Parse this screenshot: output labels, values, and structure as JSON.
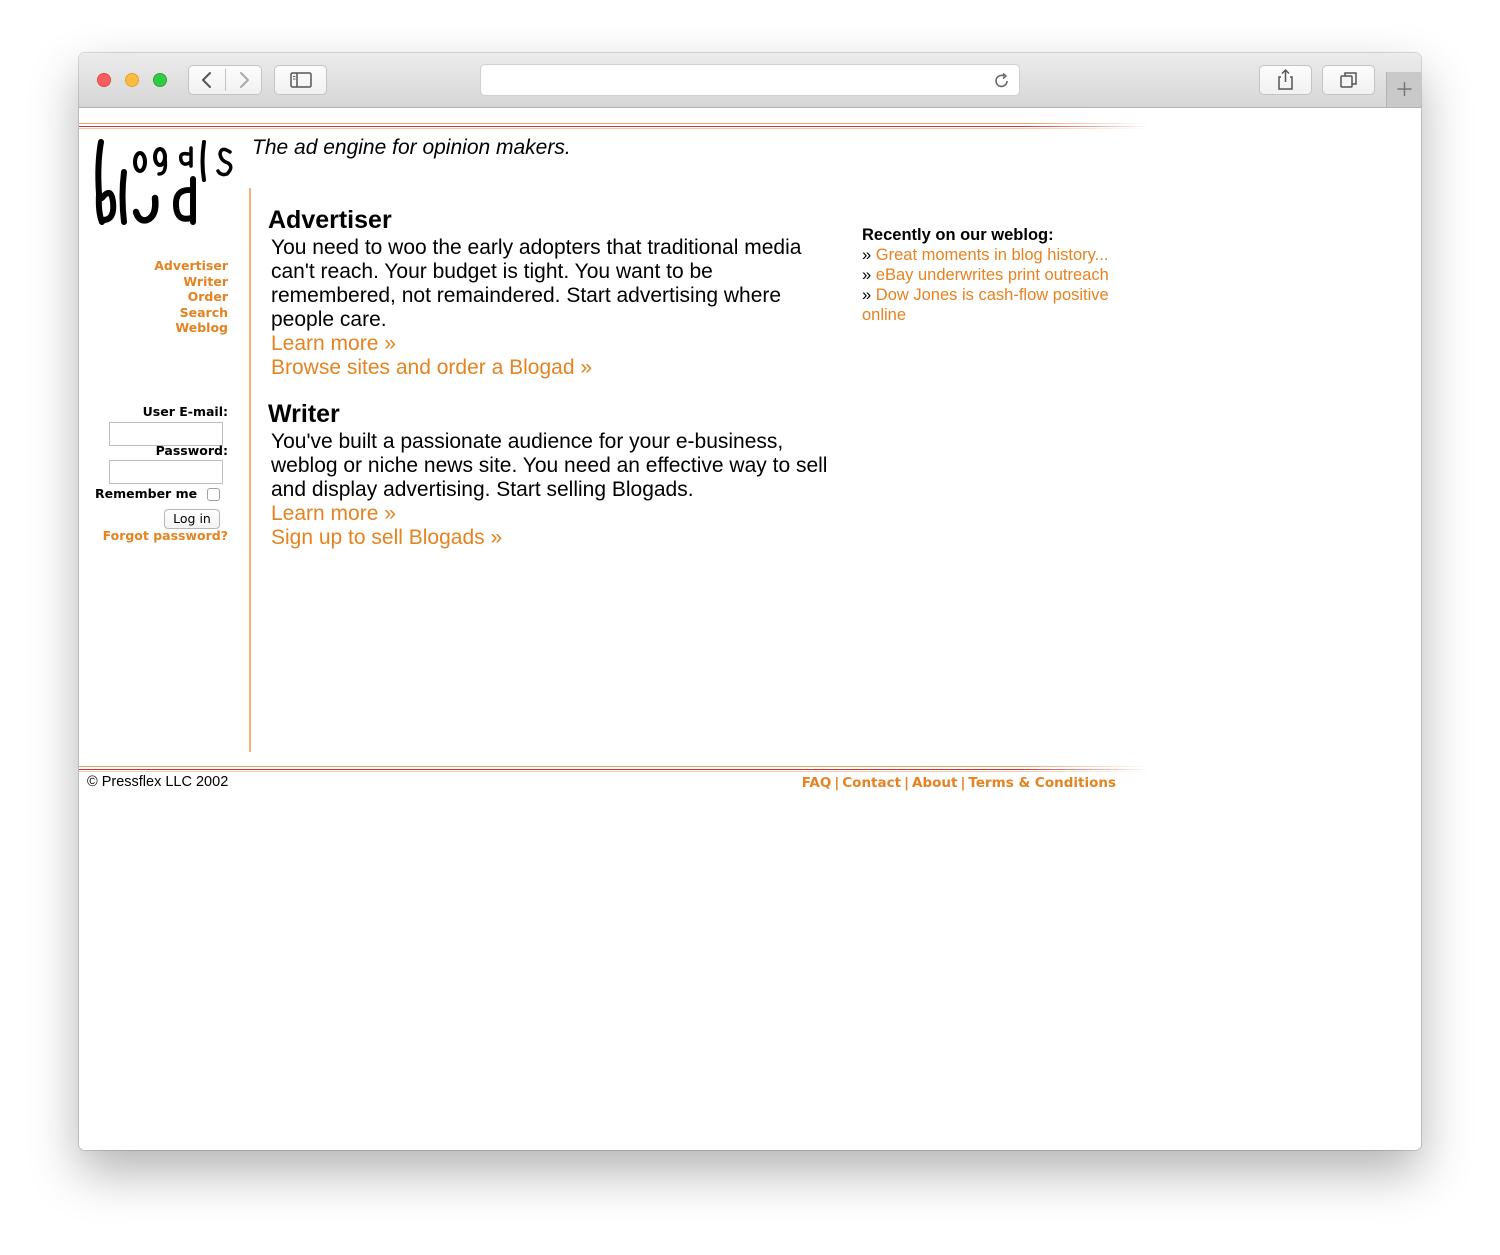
{
  "browser": {
    "icons": [
      "chevron-left-icon",
      "chevron-right-icon",
      "sidebar-icon",
      "reload-icon",
      "share-icon",
      "tabs-icon",
      "plus-icon"
    ],
    "address_text": ""
  },
  "site": {
    "tagline": "The ad engine for opinion makers.",
    "logo_letters": "blogads",
    "nav": [
      "Advertiser",
      "Writer",
      "Order",
      "Search",
      "Weblog"
    ],
    "login": {
      "email_label": "User E-mail:",
      "password_label": "Password:",
      "remember_label": "Remember me",
      "button_label": "Log in",
      "forgot_label": "Forgot password?"
    },
    "advertiser": {
      "heading": "Advertiser",
      "body": "You need to woo the early adopters that traditional media can't reach. Your budget is tight. You want to be remembered, not remaindered. Start advertising where people care.",
      "link1": "Learn more »",
      "link2": "Browse sites and order a Blogad »"
    },
    "writer": {
      "heading": "Writer",
      "body": "You've built a passionate audience for your e-business, weblog or niche news site. You need an effective way to sell and display advertising. Start selling Blogads.",
      "link1": "Learn more »",
      "link2": "Sign up to sell Blogads »"
    },
    "recent": {
      "heading": "Recently on our weblog:",
      "bullet": "»",
      "items": [
        "Great moments in blog history...",
        "eBay underwrites print outreach",
        "Dow Jones is cash-flow positive online"
      ]
    },
    "footer": {
      "copyright": "© Pressflex LLC 2002",
      "links": [
        "FAQ",
        "Contact",
        "About",
        "Terms & Conditions"
      ],
      "separator": "|"
    },
    "colors": {
      "link": "#e6821f",
      "divider": "#f2b27b",
      "rule_red": "#c9323a"
    }
  }
}
